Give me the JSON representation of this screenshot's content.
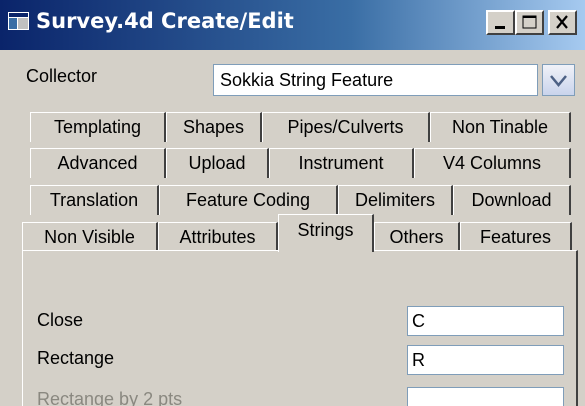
{
  "window": {
    "title": "Survey.4d Create/Edit",
    "title_bar_color": "#0a246a"
  },
  "collector": {
    "label": "Collector",
    "value": "Sokkia String Feature"
  },
  "tabs": {
    "row1": [
      "Templating",
      "Shapes",
      "Pipes/Culverts",
      "Non Tinable"
    ],
    "row2": [
      "Advanced",
      "Upload",
      "Instrument",
      "V4 Columns"
    ],
    "row3": [
      "Translation",
      "Feature Coding",
      "Delimiters",
      "Download"
    ],
    "row4": [
      "Non Visible",
      "Attributes",
      "Strings",
      "Others",
      "Features"
    ],
    "active": "Strings"
  },
  "fields": [
    {
      "label": "Close",
      "value": "C",
      "enabled": true
    },
    {
      "label": "Rectange",
      "value": "R",
      "enabled": true
    },
    {
      "label": "Rectange by 2 pts",
      "value": "",
      "enabled": false
    }
  ]
}
